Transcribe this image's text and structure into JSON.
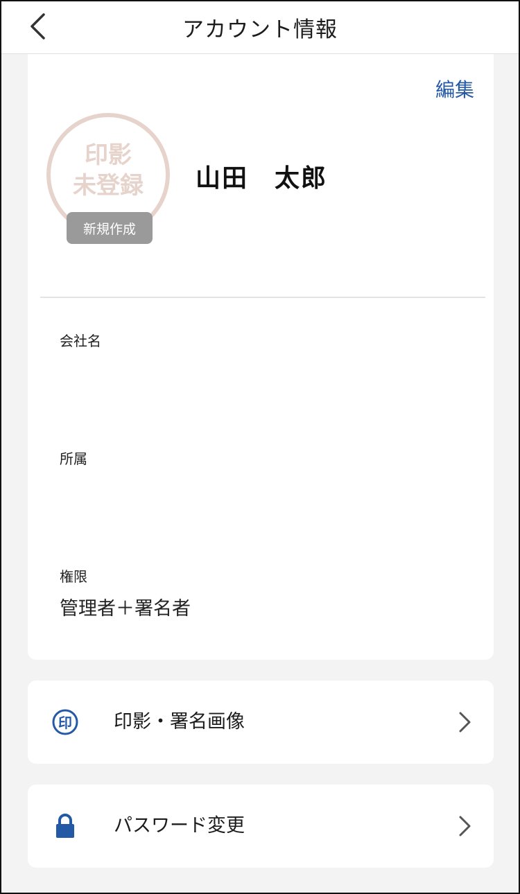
{
  "header": {
    "title": "アカウント情報"
  },
  "profile": {
    "edit_label": "編集",
    "stamp_text_line1": "印影",
    "stamp_text_line2": "未登録",
    "new_button_label": "新規作成",
    "name": "山田　太郎",
    "fields": [
      {
        "label": "会社名",
        "value": ""
      },
      {
        "label": "所属",
        "value": ""
      },
      {
        "label": "権限",
        "value": "管理者＋署名者"
      }
    ]
  },
  "menu": [
    {
      "label": "印影・署名画像",
      "icon": "seal-icon"
    },
    {
      "label": "パスワード変更",
      "icon": "lock-icon"
    }
  ],
  "colors": {
    "accent": "#2459a6",
    "stamp": "#e6d3cc",
    "background": "#f3f3f3"
  }
}
